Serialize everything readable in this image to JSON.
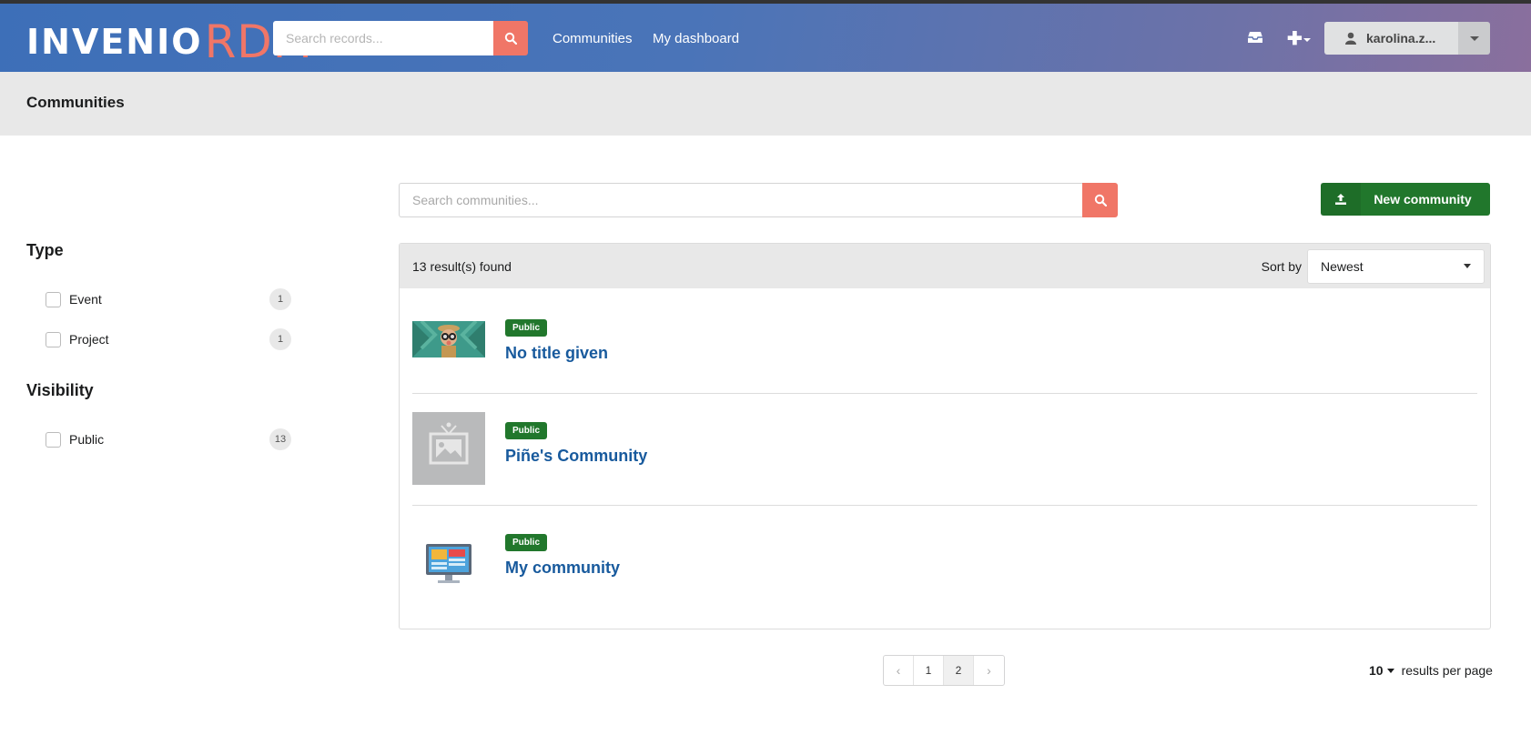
{
  "header": {
    "logo_main": "INVENIO",
    "logo_sub": "RDM",
    "search_placeholder": "Search records...",
    "nav": [
      "Communities",
      "My dashboard"
    ],
    "user": "karolina.z..."
  },
  "page_title": "Communities",
  "facets": [
    {
      "title": "Type",
      "items": [
        {
          "label": "Event",
          "count": "1"
        },
        {
          "label": "Project",
          "count": "1"
        }
      ]
    },
    {
      "title": "Visibility",
      "items": [
        {
          "label": "Public",
          "count": "13"
        }
      ]
    }
  ],
  "search": {
    "placeholder": "Search communities..."
  },
  "new_button": "New community",
  "results": {
    "count_text": "13 result(s) found",
    "sort_label": "Sort by",
    "sort_value": "Newest",
    "items": [
      {
        "badge": "Public",
        "title": "No title given",
        "thumb": "binoculars-image"
      },
      {
        "badge": "Public",
        "title": "Piñe's Community",
        "thumb": "placeholder-image"
      },
      {
        "badge": "Public",
        "title": "My community",
        "thumb": "monitor-image"
      }
    ]
  },
  "pagination": {
    "prev": "‹",
    "pages": [
      "1",
      "2"
    ],
    "next": "›",
    "active": "2"
  },
  "per_page": {
    "value": "10",
    "label": "results per page"
  },
  "colors": {
    "accent": "#f07667",
    "primary_green": "#21772c",
    "link": "#185a9d"
  }
}
